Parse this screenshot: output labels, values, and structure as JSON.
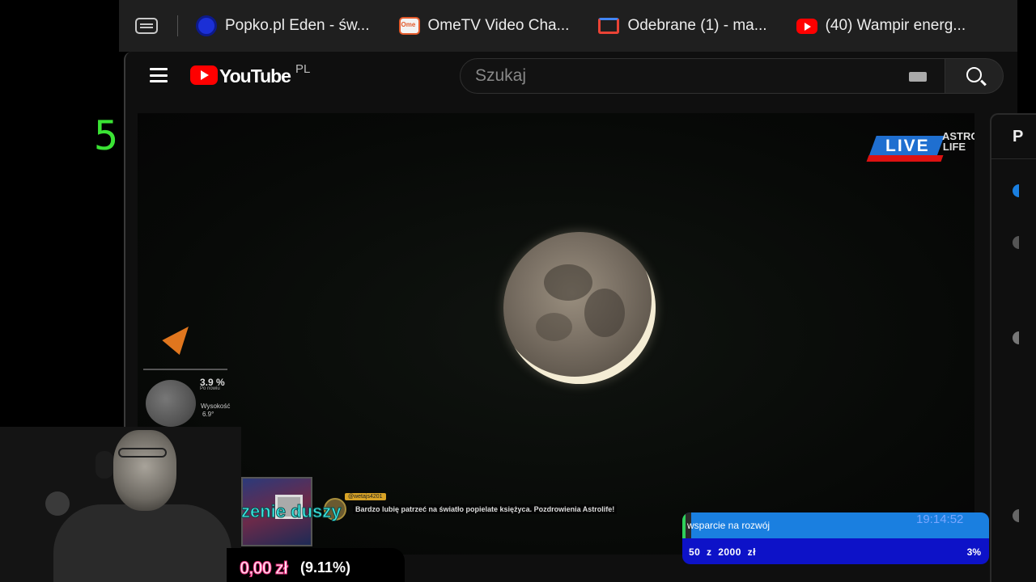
{
  "overlay": {
    "counter": "5",
    "ticker_text": "zenie duszy",
    "goal_amount": "0,00 zł",
    "goal_percent": "(9.11%)"
  },
  "browser": {
    "tabs": [
      {
        "label": "Popko.pl Eden - św...",
        "icon": "popko-favicon"
      },
      {
        "label": "OmeTV Video Cha...",
        "icon": "ometv-favicon"
      },
      {
        "label": "Odebrane (1) - ma...",
        "icon": "gmail-favicon"
      },
      {
        "label": "(40) Wampir energ...",
        "icon": "youtube-favicon"
      }
    ]
  },
  "youtube": {
    "logo_text": "YouTube",
    "country_code": "PL",
    "search_placeholder": "Szukaj",
    "side_panel_letter": "P"
  },
  "video": {
    "live_label": "LIVE",
    "channel_brand_line1": "ASTRO",
    "channel_brand_line2": "LIFE",
    "moon_phase_percent": "3.9 %",
    "moon_phase_sub": "Po nowiu",
    "altitude_label": "Wysokość",
    "altitude_value": "6.9°",
    "chat_username": "@wetajs4201",
    "chat_message": "Bardzo lubię patrzeć na światło popielate księżyca. Pozdrowienia Astrolife!"
  },
  "donation_widget": {
    "title": "wsparcie na rozwój",
    "time": "19:14:52",
    "raised": "50",
    "separator": "z",
    "target": "2000",
    "currency": "zł",
    "percent": "3%",
    "progress_fraction": 0.03
  },
  "colors": {
    "counter_green": "#3ae334",
    "ticker_cyan": "#3de6e0",
    "youtube_red": "#ff0000",
    "widget_blue": "#1a7fe0",
    "widget_navy": "#0d12c8"
  }
}
